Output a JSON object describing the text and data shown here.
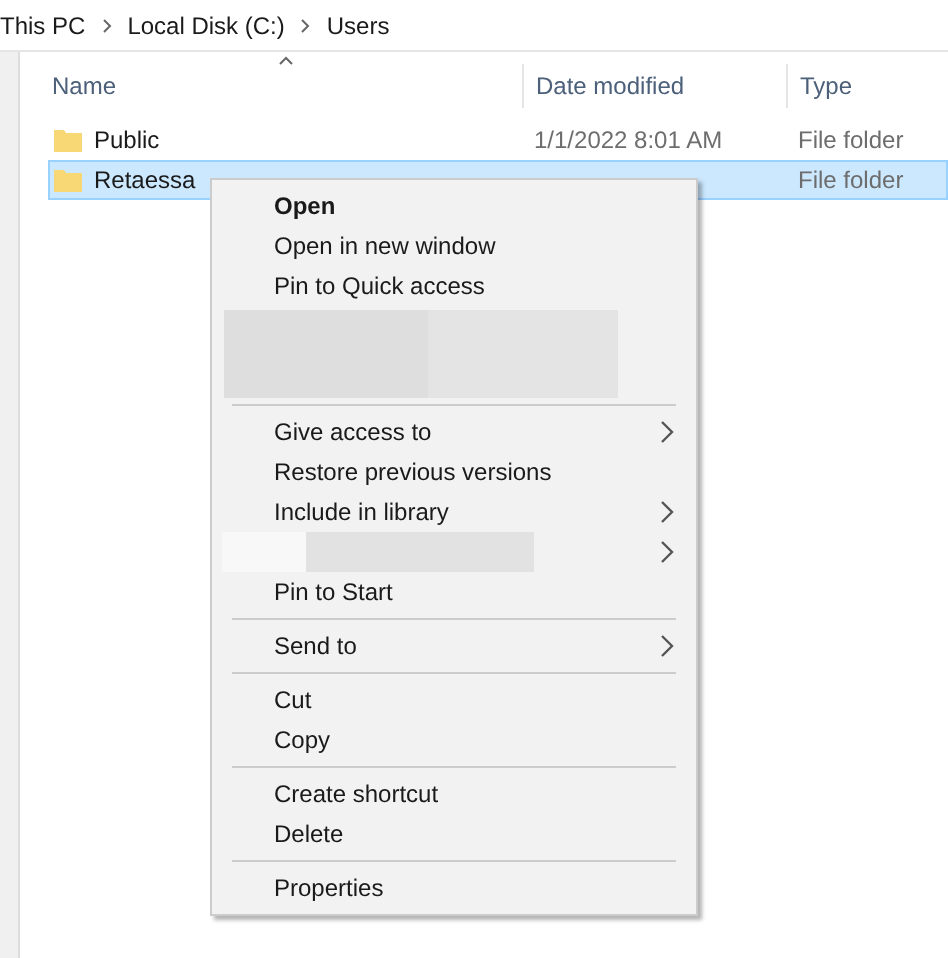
{
  "breadcrumb": [
    "This PC",
    "Local Disk (C:)",
    "Users"
  ],
  "columns": [
    {
      "label": "Name",
      "sorted": true
    },
    {
      "label": "Date modified",
      "sorted": false
    },
    {
      "label": "Type",
      "sorted": false
    }
  ],
  "rows": [
    {
      "name": "Public",
      "date": "1/1/2022 8:01 AM",
      "type": "File folder",
      "selected": false
    },
    {
      "name": "Retaessa",
      "type": "File folder",
      "selected": true
    }
  ],
  "menu": {
    "items": [
      {
        "kind": "item",
        "label": "Open",
        "default": true,
        "submenu": false
      },
      {
        "kind": "item",
        "label": "Open in new window",
        "default": false,
        "submenu": false
      },
      {
        "kind": "item",
        "label": "Pin to Quick access",
        "default": false,
        "submenu": false
      },
      {
        "kind": "redacted",
        "tall": true
      },
      {
        "kind": "separator"
      },
      {
        "kind": "item",
        "label": "Give access to",
        "default": false,
        "submenu": true
      },
      {
        "kind": "item",
        "label": "Restore previous versions",
        "default": false,
        "submenu": false
      },
      {
        "kind": "item",
        "label": "Include in library",
        "default": false,
        "submenu": true
      },
      {
        "kind": "redacted",
        "submenu": true,
        "tall": false
      },
      {
        "kind": "item",
        "label": "Pin to Start",
        "default": false,
        "submenu": false
      },
      {
        "kind": "separator"
      },
      {
        "kind": "item",
        "label": "Send to",
        "default": false,
        "submenu": true
      },
      {
        "kind": "separator"
      },
      {
        "kind": "item",
        "label": "Cut",
        "default": false,
        "submenu": false
      },
      {
        "kind": "item",
        "label": "Copy",
        "default": false,
        "submenu": false
      },
      {
        "kind": "separator"
      },
      {
        "kind": "item",
        "label": "Create shortcut",
        "default": false,
        "submenu": false
      },
      {
        "kind": "item",
        "label": "Delete",
        "default": false,
        "submenu": false
      },
      {
        "kind": "separator"
      },
      {
        "kind": "item",
        "label": "Properties",
        "default": false,
        "submenu": false
      }
    ]
  }
}
